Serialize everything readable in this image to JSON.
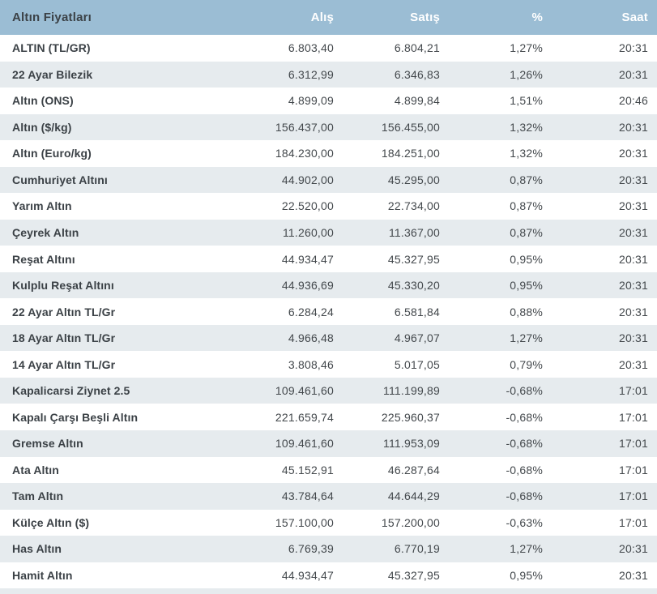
{
  "table": {
    "title": "Altın Fiyatları",
    "columns": [
      "Alış",
      "Satış",
      "%",
      "Saat"
    ],
    "rows": [
      {
        "name": "ALTIN (TL/GR)",
        "alis": "6.803,40",
        "satis": "6.804,21",
        "pct": "1,27%",
        "saat": "20:31"
      },
      {
        "name": "22 Ayar Bilezik",
        "alis": "6.312,99",
        "satis": "6.346,83",
        "pct": "1,26%",
        "saat": "20:31"
      },
      {
        "name": "Altın (ONS)",
        "alis": "4.899,09",
        "satis": "4.899,84",
        "pct": "1,51%",
        "saat": "20:46"
      },
      {
        "name": "Altın ($/kg)",
        "alis": "156.437,00",
        "satis": "156.455,00",
        "pct": "1,32%",
        "saat": "20:31"
      },
      {
        "name": "Altın (Euro/kg)",
        "alis": "184.230,00",
        "satis": "184.251,00",
        "pct": "1,32%",
        "saat": "20:31"
      },
      {
        "name": "Cumhuriyet Altını",
        "alis": "44.902,00",
        "satis": "45.295,00",
        "pct": "0,87%",
        "saat": "20:31"
      },
      {
        "name": "Yarım Altın",
        "alis": "22.520,00",
        "satis": "22.734,00",
        "pct": "0,87%",
        "saat": "20:31"
      },
      {
        "name": "Çeyrek Altın",
        "alis": "11.260,00",
        "satis": "11.367,00",
        "pct": "0,87%",
        "saat": "20:31"
      },
      {
        "name": "Reşat Altını",
        "alis": "44.934,47",
        "satis": "45.327,95",
        "pct": "0,95%",
        "saat": "20:31"
      },
      {
        "name": "Kulplu Reşat Altını",
        "alis": "44.936,69",
        "satis": "45.330,20",
        "pct": "0,95%",
        "saat": "20:31"
      },
      {
        "name": "22 Ayar Altın TL/Gr",
        "alis": "6.284,24",
        "satis": "6.581,84",
        "pct": "0,88%",
        "saat": "20:31"
      },
      {
        "name": "18 Ayar Altın TL/Gr",
        "alis": "4.966,48",
        "satis": "4.967,07",
        "pct": "1,27%",
        "saat": "20:31"
      },
      {
        "name": "14 Ayar Altın TL/Gr",
        "alis": "3.808,46",
        "satis": "5.017,05",
        "pct": "0,79%",
        "saat": "20:31"
      },
      {
        "name": "Kapalicarsi Ziynet 2.5",
        "alis": "109.461,60",
        "satis": "111.199,89",
        "pct": "-0,68%",
        "saat": "17:01"
      },
      {
        "name": "Kapalı Çarşı Beşli Altın",
        "alis": "221.659,74",
        "satis": "225.960,37",
        "pct": "-0,68%",
        "saat": "17:01"
      },
      {
        "name": "Gremse Altın",
        "alis": "109.461,60",
        "satis": "111.953,09",
        "pct": "-0,68%",
        "saat": "17:01"
      },
      {
        "name": "Ata Altın",
        "alis": "45.152,91",
        "satis": "46.287,64",
        "pct": "-0,68%",
        "saat": "17:01"
      },
      {
        "name": "Tam Altın",
        "alis": "43.784,64",
        "satis": "44.644,29",
        "pct": "-0,68%",
        "saat": "17:01"
      },
      {
        "name": "Külçe Altın ($)",
        "alis": "157.100,00",
        "satis": "157.200,00",
        "pct": "-0,63%",
        "saat": "17:01"
      },
      {
        "name": "Has Altın",
        "alis": "6.769,39",
        "satis": "6.770,19",
        "pct": "1,27%",
        "saat": "20:31"
      },
      {
        "name": "Hamit Altın",
        "alis": "44.934,47",
        "satis": "45.327,95",
        "pct": "0,95%",
        "saat": "20:31"
      }
    ]
  },
  "colors": {
    "header_bg": "#9bbdd4",
    "header_text": "#ffffff",
    "row_bg": "#ffffff",
    "row_alt_bg": "#e6ebee",
    "label_text": "#3b4146",
    "value_text": "#43484c"
  }
}
